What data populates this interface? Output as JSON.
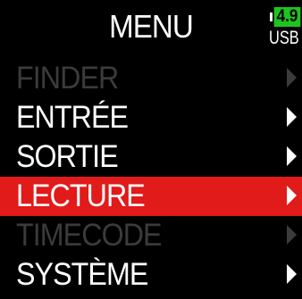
{
  "header": {
    "title": "MENU",
    "battery_level": "4.9",
    "power_source": "USB"
  },
  "menu": {
    "items": [
      {
        "label": "FINDER",
        "state": "disabled"
      },
      {
        "label": "ENTRÉE",
        "state": "enabled"
      },
      {
        "label": "SORTIE",
        "state": "enabled"
      },
      {
        "label": "LECTURE",
        "state": "selected"
      },
      {
        "label": "TIMECODE",
        "state": "disabled"
      },
      {
        "label": "SYSTÈME",
        "state": "enabled"
      }
    ]
  },
  "colors": {
    "background": "#000000",
    "selected_row": "#e11a1a",
    "battery": "#1ec41e",
    "disabled_text": "#3b3b3b",
    "enabled_text": "#ffffff"
  }
}
